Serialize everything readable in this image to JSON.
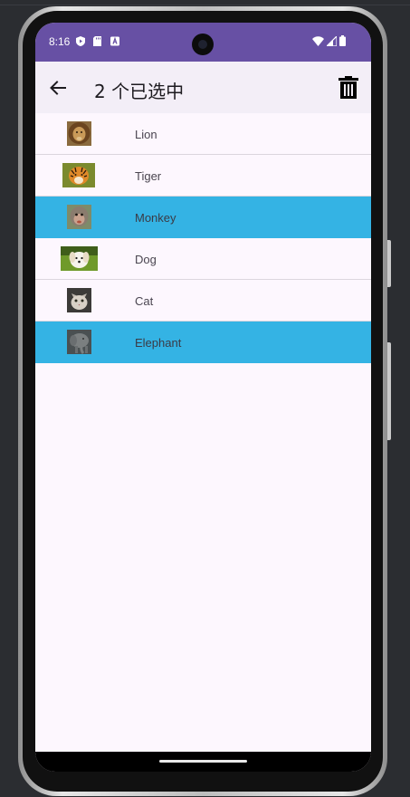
{
  "status_bar": {
    "time": "8:16",
    "left_icons": [
      "play-protect-icon",
      "sd-card-icon",
      "a-notification-icon"
    ],
    "right_icons": [
      "wifi-icon",
      "signal-icon",
      "battery-icon"
    ],
    "background": "#6750a4"
  },
  "app_bar": {
    "title": "2 个已选中",
    "back_icon": "arrow-back-icon",
    "delete_icon": "trash-icon",
    "background": "#f3eef7"
  },
  "list": {
    "selected_color": "#34b3e4",
    "items": [
      {
        "label": "Lion",
        "thumb_icon": "lion-thumbnail",
        "selected": false
      },
      {
        "label": "Tiger",
        "thumb_icon": "tiger-thumbnail",
        "selected": false
      },
      {
        "label": "Monkey",
        "thumb_icon": "monkey-thumbnail",
        "selected": true
      },
      {
        "label": "Dog",
        "thumb_icon": "dog-thumbnail",
        "selected": false
      },
      {
        "label": "Cat",
        "thumb_icon": "cat-thumbnail",
        "selected": false
      },
      {
        "label": "Elephant",
        "thumb_icon": "elephant-thumbnail",
        "selected": true
      }
    ]
  }
}
